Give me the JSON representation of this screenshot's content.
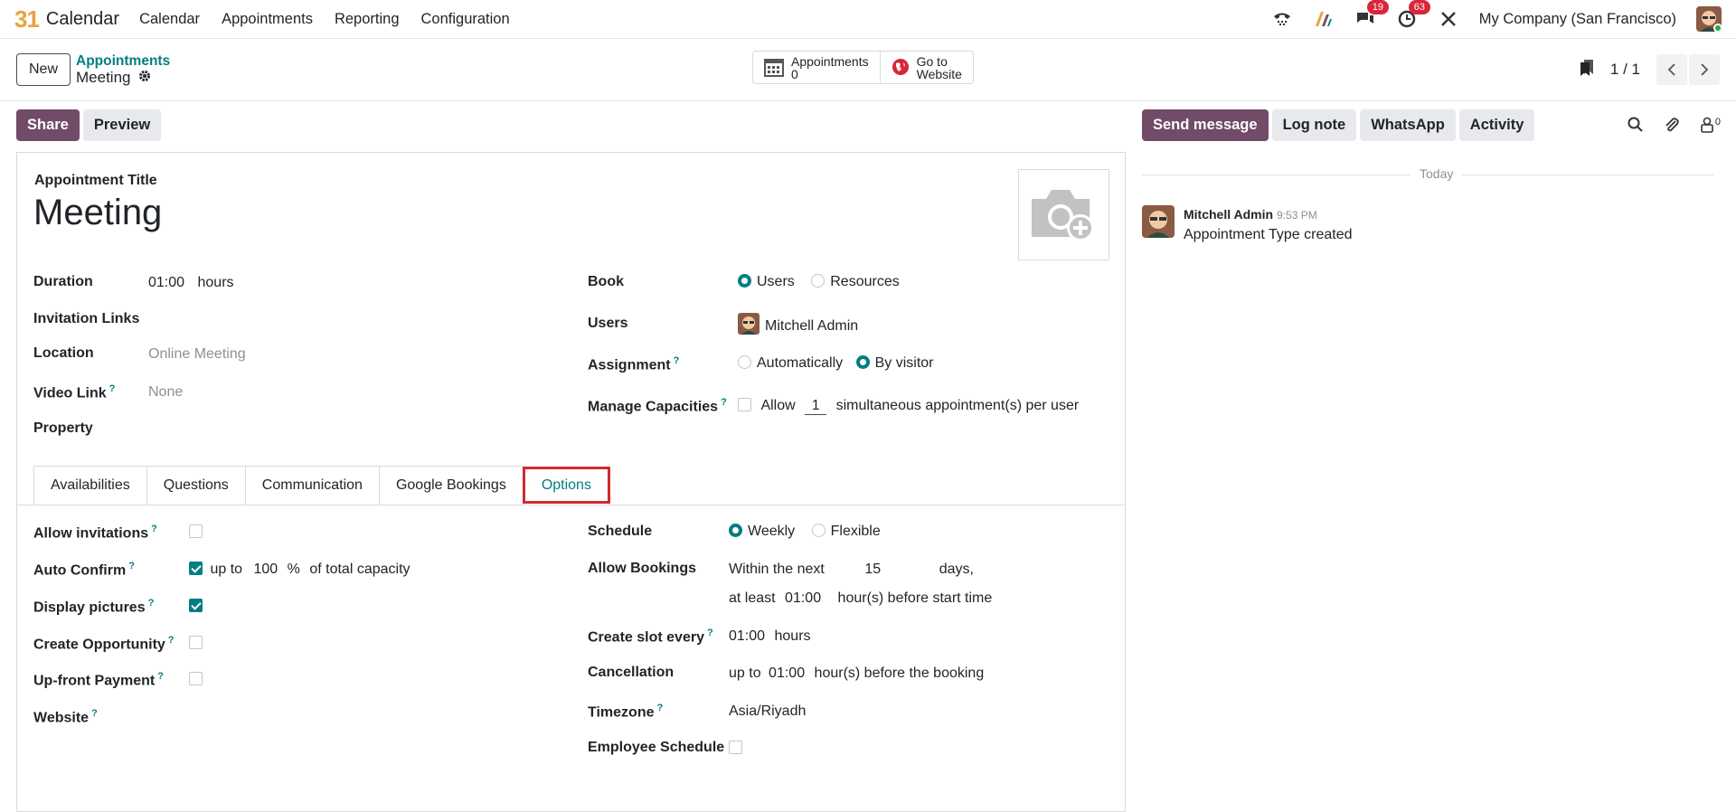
{
  "topnav": {
    "brand_logo": "31",
    "app_name": "Calendar",
    "menu": [
      "Calendar",
      "Appointments",
      "Reporting",
      "Configuration"
    ],
    "messages_count": "19",
    "activities_count": "63",
    "company": "My Company (San Francisco)"
  },
  "control": {
    "new_label": "New",
    "breadcrumb_parent": "Appointments",
    "breadcrumb_current": "Meeting",
    "smart_appointments_label": "Appointments",
    "smart_appointments_count": "0",
    "smart_website_line1": "Go to",
    "smart_website_line2": "Website",
    "pager": "1 / 1"
  },
  "actions": {
    "share": "Share",
    "preview": "Preview"
  },
  "form": {
    "title_label": "Appointment Title",
    "title_value": "Meeting",
    "duration_label": "Duration",
    "duration_value": "01:00",
    "duration_unit": "hours",
    "invitation_links_label": "Invitation Links",
    "location_label": "Location",
    "location_placeholder": "Online Meeting",
    "video_link_label": "Video Link",
    "video_link_value": "None",
    "property_label": "Property",
    "book_label": "Book",
    "book_users": "Users",
    "book_resources": "Resources",
    "users_label": "Users",
    "users_value": "Mitchell Admin",
    "assignment_label": "Assignment",
    "assignment_auto": "Automatically",
    "assignment_visitor": "By visitor",
    "capacities_label": "Manage Capacities",
    "capacities_allow": "Allow",
    "capacities_value": "1",
    "capacities_suffix": "simultaneous appointment(s) per user"
  },
  "tabs": [
    "Availabilities",
    "Questions",
    "Communication",
    "Google Bookings",
    "Options"
  ],
  "options": {
    "allow_invitations": "Allow invitations",
    "auto_confirm": "Auto Confirm",
    "auto_confirm_upto": "up to",
    "auto_confirm_value": "100",
    "auto_confirm_pct": "%",
    "auto_confirm_suffix": "of total capacity",
    "display_pictures": "Display pictures",
    "create_opportunity": "Create Opportunity",
    "upfront_payment": "Up-front Payment",
    "website": "Website",
    "schedule_label": "Schedule",
    "schedule_weekly": "Weekly",
    "schedule_flexible": "Flexible",
    "allow_bookings_label": "Allow Bookings",
    "within_next": "Within the next",
    "within_value": "15",
    "within_unit": "days,",
    "at_least": "at least",
    "at_least_value": "01:00",
    "at_least_suffix": "hour(s) before start time",
    "create_slot_label": "Create slot every",
    "create_slot_value": "01:00",
    "create_slot_unit": "hours",
    "cancellation_label": "Cancellation",
    "cancellation_upto": "up to",
    "cancellation_value": "01:00",
    "cancellation_suffix": "hour(s) before the booking",
    "timezone_label": "Timezone",
    "timezone_value": "Asia/Riyadh",
    "employee_schedule_label": "Employee Schedule"
  },
  "chatter": {
    "send_message": "Send message",
    "log_note": "Log note",
    "whatsapp": "WhatsApp",
    "activity": "Activity",
    "followers_count": "0",
    "today": "Today",
    "author": "Mitchell Admin",
    "time": "9:53 PM",
    "body": "Appointment Type created"
  },
  "colors": {
    "primary": "#714b67",
    "teal": "#017e84",
    "highlight": "#d22b2b",
    "badge": "#d9263a"
  }
}
